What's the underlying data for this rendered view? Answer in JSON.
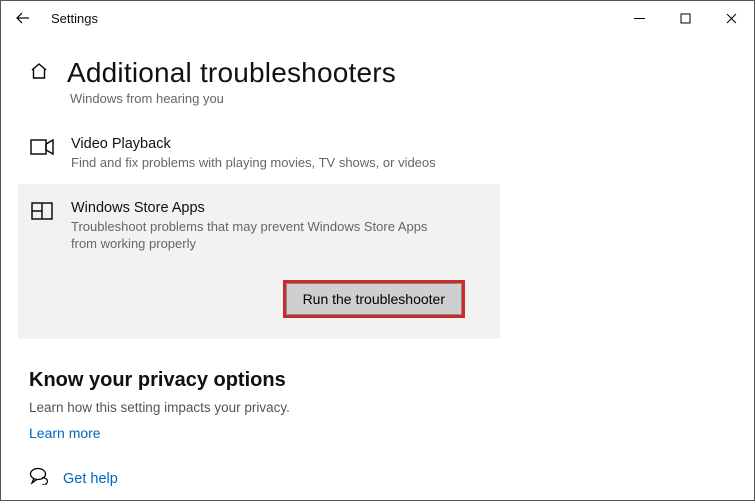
{
  "titlebar": {
    "title": "Settings"
  },
  "page": {
    "heading": "Additional troubleshooters",
    "crumb": "Windows from hearing you"
  },
  "items": {
    "video": {
      "title": "Video Playback",
      "desc": "Find and fix problems with playing movies, TV shows, or videos"
    },
    "store": {
      "title": "Windows Store Apps",
      "desc": "Troubleshoot problems that may prevent Windows Store Apps from working properly",
      "run_label": "Run the troubleshooter"
    }
  },
  "privacy": {
    "heading": "Know your privacy options",
    "desc": "Learn how this setting impacts your privacy.",
    "learn_more": "Learn more"
  },
  "footer": {
    "get_help": "Get help"
  }
}
